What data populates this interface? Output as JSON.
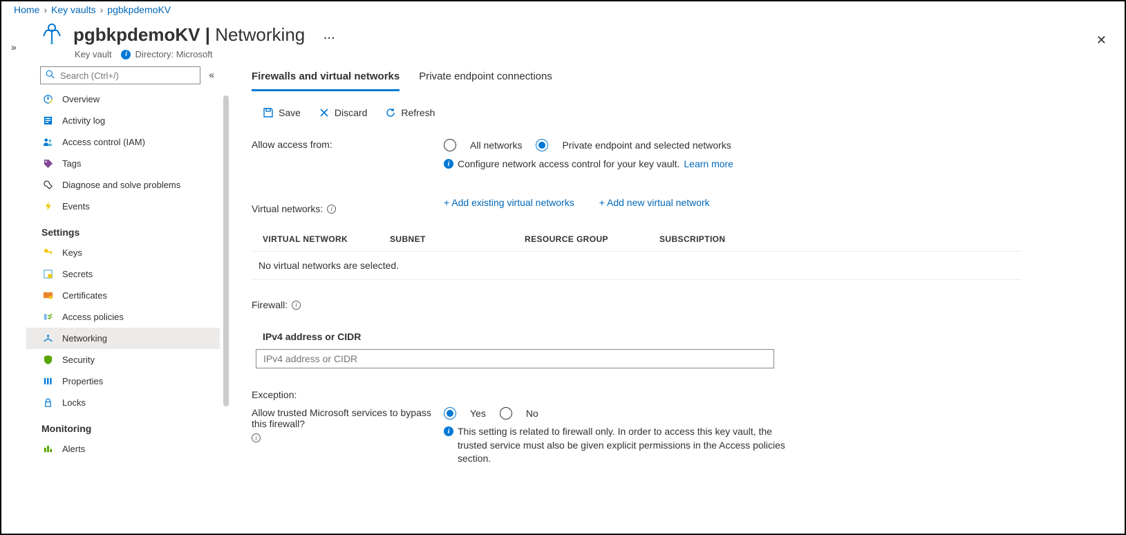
{
  "breadcrumb": {
    "home": "Home",
    "level1": "Key vaults",
    "level2": "pgbkpdemoKV"
  },
  "header": {
    "resource_name": "pgbkpdemoKV",
    "page_name": "Networking",
    "resource_type": "Key vault",
    "directory_label": "Directory: Microsoft"
  },
  "search": {
    "placeholder": "Search (Ctrl+/)"
  },
  "sidebar": {
    "items_top": [
      {
        "label": "Overview"
      },
      {
        "label": "Activity log"
      },
      {
        "label": "Access control (IAM)"
      },
      {
        "label": "Tags"
      },
      {
        "label": "Diagnose and solve problems"
      },
      {
        "label": "Events"
      }
    ],
    "group_settings": "Settings",
    "items_settings": [
      {
        "label": "Keys"
      },
      {
        "label": "Secrets"
      },
      {
        "label": "Certificates"
      },
      {
        "label": "Access policies"
      },
      {
        "label": "Networking"
      },
      {
        "label": "Security"
      },
      {
        "label": "Properties"
      },
      {
        "label": "Locks"
      }
    ],
    "group_monitoring": "Monitoring",
    "items_monitoring": [
      {
        "label": "Alerts"
      }
    ]
  },
  "tabs": {
    "t1": "Firewalls and virtual networks",
    "t2": "Private endpoint connections"
  },
  "toolbar": {
    "save": "Save",
    "discard": "Discard",
    "refresh": "Refresh"
  },
  "access": {
    "label": "Allow access from:",
    "opt_all": "All networks",
    "opt_private": "Private endpoint and selected networks",
    "hint": "Configure network access control for your key vault.",
    "learn": "Learn more"
  },
  "vnet": {
    "label": "Virtual networks:",
    "add_existing": "+ Add existing virtual networks",
    "add_new": "+ Add new virtual network",
    "col_vn": "VIRTUAL NETWORK",
    "col_sub": "SUBNET",
    "col_rg": "RESOURCE GROUP",
    "col_sc": "SUBSCRIPTION",
    "empty": "No virtual networks are selected."
  },
  "firewall": {
    "label": "Firewall:",
    "ip_header": "IPv4 address or CIDR",
    "ip_placeholder": "IPv4 address or CIDR"
  },
  "exception": {
    "header": "Exception:",
    "question": "Allow trusted Microsoft services to bypass this firewall?",
    "yes": "Yes",
    "no": "No",
    "note": "This setting is related to firewall only. In order to access this key vault, the trusted service must also be given explicit permissions in the Access policies section."
  }
}
